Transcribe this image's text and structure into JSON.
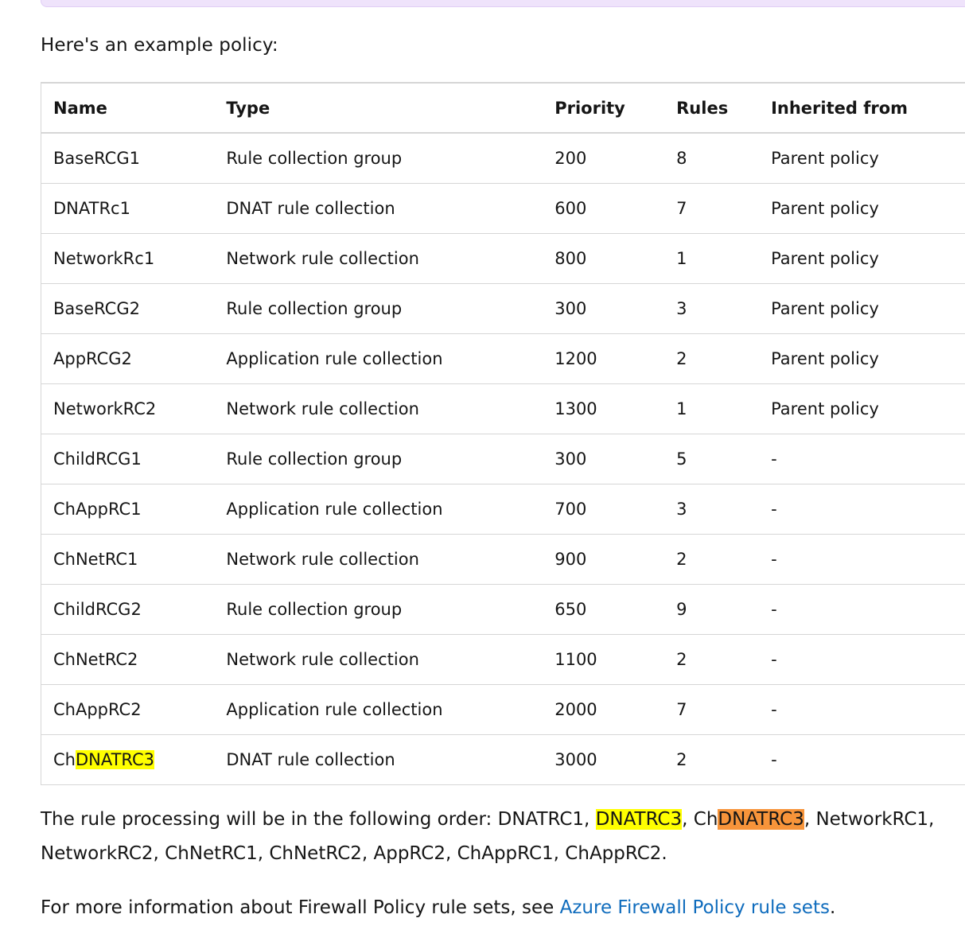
{
  "intro": "Here's an example policy:",
  "table": {
    "headers": [
      "Name",
      "Type",
      "Priority",
      "Rules",
      "Inherited from"
    ],
    "rows": [
      [
        "BaseRCG1",
        "Rule collection group",
        "200",
        "8",
        "Parent policy"
      ],
      [
        "DNATRc1",
        "DNAT rule collection",
        "600",
        "7",
        "Parent policy"
      ],
      [
        "NetworkRc1",
        "Network rule collection",
        "800",
        "1",
        "Parent policy"
      ],
      [
        "BaseRCG2",
        "Rule collection group",
        "300",
        "3",
        "Parent policy"
      ],
      [
        "AppRCG2",
        "Application rule collection",
        "1200",
        "2",
        "Parent policy"
      ],
      [
        "NetworkRC2",
        "Network rule collection",
        "1300",
        "1",
        "Parent policy"
      ],
      [
        "ChildRCG1",
        "Rule collection group",
        "300",
        "5",
        "-"
      ],
      [
        "ChAppRC1",
        "Application rule collection",
        "700",
        "3",
        "-"
      ],
      [
        "ChNetRC1",
        "Network rule collection",
        "900",
        "2",
        "-"
      ],
      [
        "ChildRCG2",
        "Rule collection group",
        "650",
        "9",
        "-"
      ],
      [
        "ChNetRC2",
        "Network rule collection",
        "1100",
        "2",
        "-"
      ],
      [
        "ChAppRC2",
        "Application rule collection",
        "2000",
        "7",
        "-"
      ]
    ],
    "last_row": {
      "name_prefix": "Ch",
      "name_highlight": "DNATRC3",
      "type": "DNAT rule collection",
      "priority": "3000",
      "rules": "2",
      "inherited": "-"
    }
  },
  "order": {
    "prefix": "The rule processing will be in the following order: DNATRC1, ",
    "highlight1": "DNATRC3",
    "mid": ", Ch",
    "highlight2": "DNATRC3",
    "suffix": ", NetworkRC1, NetworkRC2, ChNetRC1, ChNetRC2, AppRC2, ChAppRC1, ChAppRC2."
  },
  "more": {
    "text": "For more information about Firewall Policy rule sets, see ",
    "link": "Azure Firewall Policy rule sets",
    "end": "."
  },
  "colors": {
    "yellow_highlight": "#ffff00",
    "orange_highlight": "#f7943a",
    "link": "#0f6cbd"
  }
}
